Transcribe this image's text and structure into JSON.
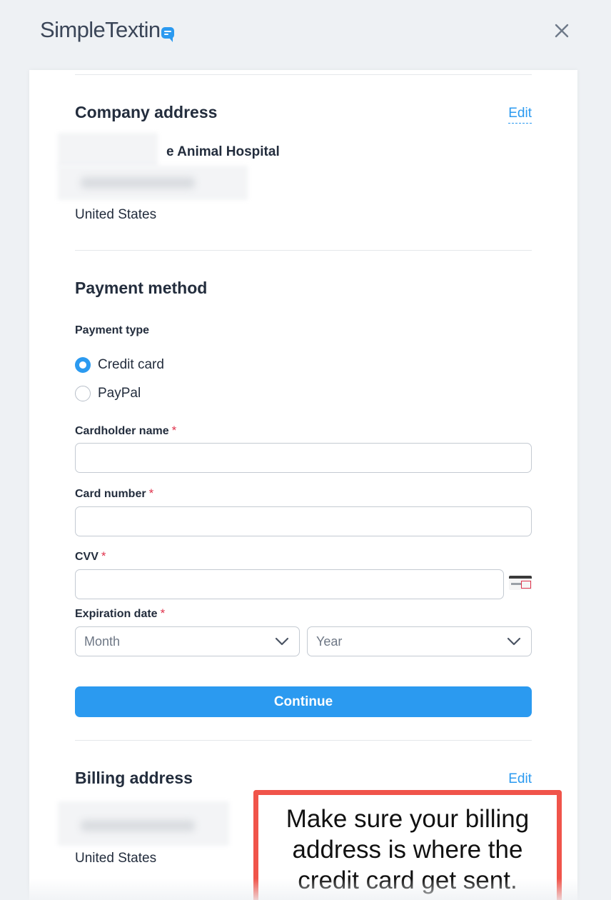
{
  "header": {
    "logo_text": "SimpleTextin",
    "logo_icon": "chat-bubble-icon",
    "close_icon": "close-icon"
  },
  "company_address": {
    "title": "Company address",
    "edit_label": "Edit",
    "company_name_visible": "e Animal Hospital",
    "country": "United States"
  },
  "payment_method": {
    "title": "Payment method",
    "payment_type_label": "Payment type",
    "options": [
      {
        "label": "Credit card",
        "selected": true
      },
      {
        "label": "PayPal",
        "selected": false
      }
    ],
    "fields": {
      "cardholder_name": {
        "label": "Cardholder name",
        "required_mark": "*",
        "value": ""
      },
      "card_number": {
        "label": "Card number",
        "required_mark": "*",
        "value": ""
      },
      "cvv": {
        "label": "CVV",
        "required_mark": "*",
        "value": "",
        "icon": "card-cvv-icon"
      },
      "expiration_date": {
        "label": "Expiration date",
        "required_mark": "*",
        "month_placeholder": "Month",
        "year_placeholder": "Year"
      }
    },
    "continue_label": "Continue"
  },
  "billing_address": {
    "title": "Billing address",
    "edit_label": "Edit",
    "country": "United States"
  },
  "annotation": {
    "text": "Make sure your billing address is where the credit card get sent."
  },
  "colors": {
    "accent": "#2b9af0",
    "required": "#e0344d",
    "callout_border": "#f0544a",
    "background": "#eef1f4"
  }
}
